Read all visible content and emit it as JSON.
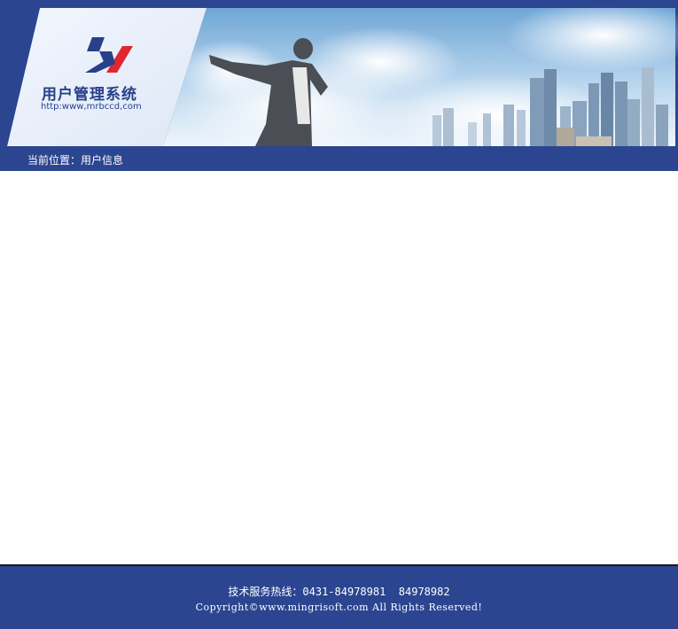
{
  "header": {
    "app_title": "用户管理系统",
    "app_url": "http:www,mrbccd,com",
    "logo_icon": "mr-logo-icon",
    "banner_image": "businessman-city-skyline"
  },
  "breadcrumb": {
    "text": "当前位置：用户信息"
  },
  "footer": {
    "hotline": "技术服务热线：0431-84978981  84978982",
    "copyright": "Copyright©www.mingrisoft.com All Rights Reserved!"
  },
  "colors": {
    "brand_blue": "#2b4590",
    "logo_red": "#e0262e",
    "background": "#ffffff"
  }
}
